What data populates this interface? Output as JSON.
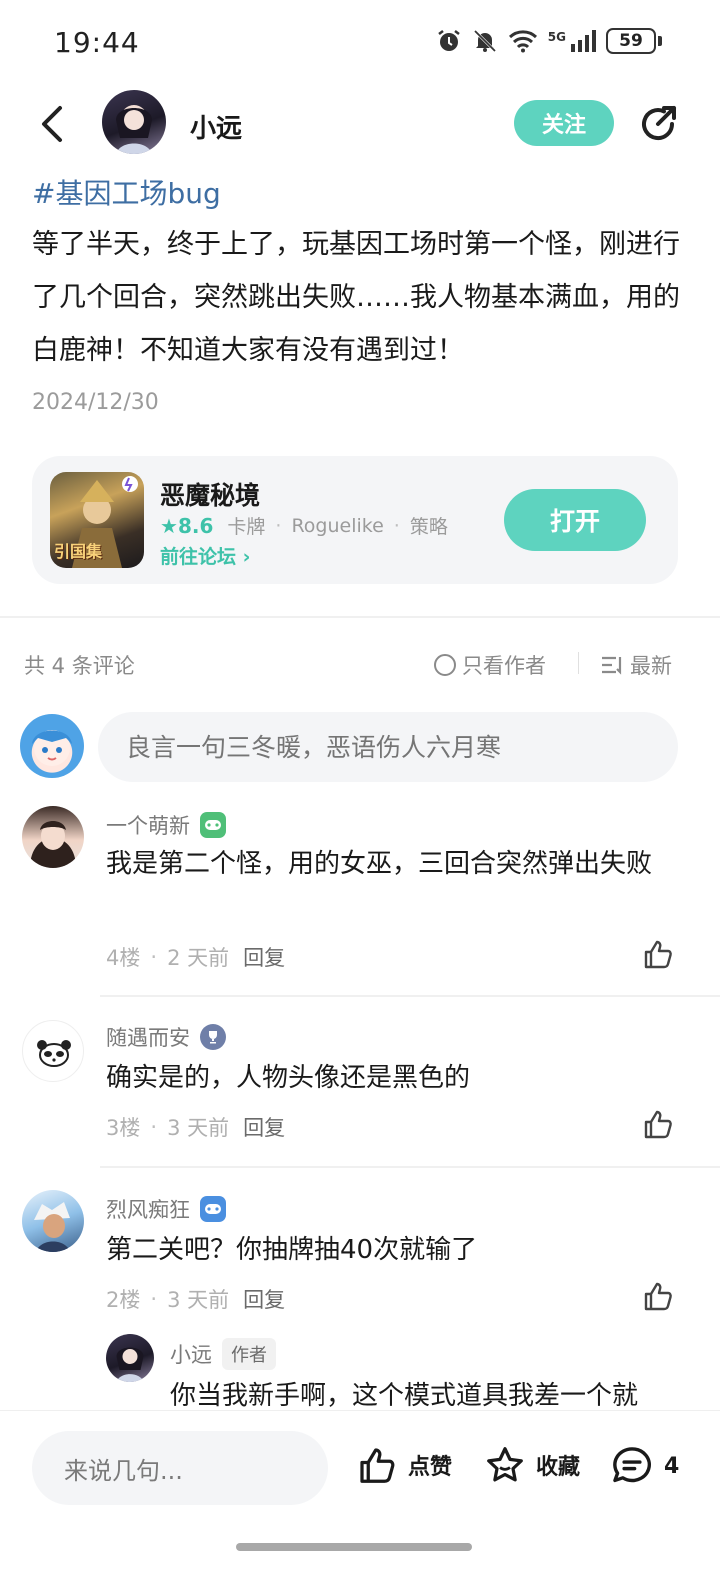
{
  "status_bar": {
    "time": "19:44",
    "network": "5G",
    "battery": "59"
  },
  "header": {
    "author_name": "小远",
    "follow_label": "关注"
  },
  "post": {
    "tag": "#基因工场bug",
    "body": "等了半天，终于上了，玩基因工场时第一个怪，刚进行了几个回合，突然跳出失败……我人物基本满血，用的白鹿神！不知道大家有没有遇到过！",
    "date": "2024/12/30"
  },
  "game_card": {
    "title": "恶魔秘境",
    "score": "8.6",
    "tags": [
      "卡牌",
      "Roguelike",
      "策略"
    ],
    "forum_link": "前往论坛",
    "open_label": "打开",
    "icon_caption": "引国集"
  },
  "comments_header": {
    "count_text": "共 4 条评论",
    "author_only": "只看作者",
    "sort": "最新"
  },
  "comment_input": {
    "placeholder": "良言一句三冬暖，恶语伤人六月寒"
  },
  "comments": [
    {
      "name": "一个萌新",
      "badge_icon": "gamepad-green-icon",
      "text": "我是第二个怪，用的女巫，三回合突然弹出失败",
      "floor": "4楼",
      "time": "2 天前",
      "reply_label": "回复"
    },
    {
      "name": "随遇而安",
      "badge_icon": "trophy-icon",
      "text": "确实是的，人物头像还是黑色的",
      "floor": "3楼",
      "time": "3 天前",
      "reply_label": "回复"
    },
    {
      "name": "烈风痴狂",
      "badge_icon": "gamepad-blue-icon",
      "text": "第二关吧？你抽牌抽40次就输了",
      "floor": "2楼",
      "time": "3 天前",
      "reply_label": "回复"
    }
  ],
  "nested_reply": {
    "name": "小远",
    "author_tag": "作者",
    "text": "你当我新手啊，这个模式道具我差一个就"
  },
  "bottom_bar": {
    "input_placeholder": "来说几句...",
    "like_label": "点赞",
    "favorite_label": "收藏",
    "comment_count": "4"
  },
  "colors": {
    "accent": "#5ed3bf",
    "tag_link": "#3e6ea3",
    "muted": "#9b9b9b"
  }
}
